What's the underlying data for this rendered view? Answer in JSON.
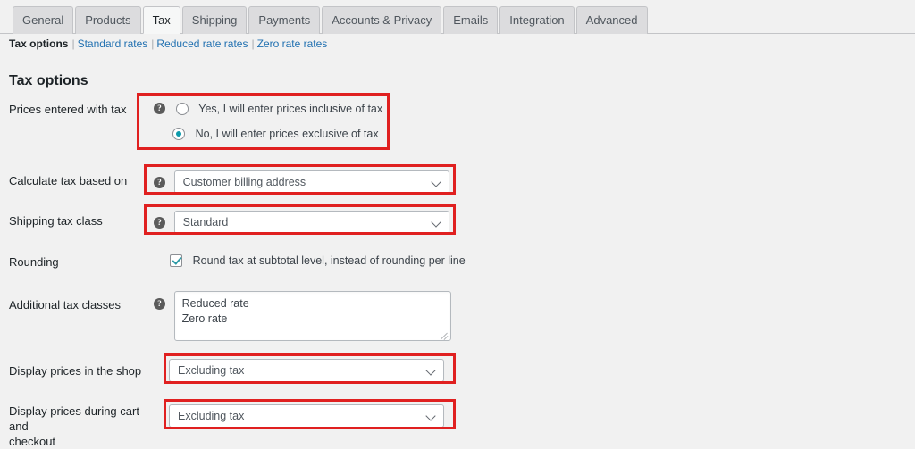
{
  "colors": {
    "accent_teal": "#0d9aab",
    "link_blue": "#2271b1",
    "annotation_red": "#e02020",
    "page_bg": "#f1f1f1"
  },
  "tabs": [
    {
      "label": "General",
      "active": false
    },
    {
      "label": "Products",
      "active": false
    },
    {
      "label": "Tax",
      "active": true
    },
    {
      "label": "Shipping",
      "active": false
    },
    {
      "label": "Payments",
      "active": false
    },
    {
      "label": "Accounts & Privacy",
      "active": false
    },
    {
      "label": "Emails",
      "active": false
    },
    {
      "label": "Integration",
      "active": false
    },
    {
      "label": "Advanced",
      "active": false
    }
  ],
  "subnav": {
    "current": "Tax options",
    "sep1": "|",
    "link1": "Standard rates",
    "sep2": "|",
    "link2": "Reduced rate rates",
    "sep3": "|",
    "link3": "Zero rate rates"
  },
  "heading": "Tax options",
  "help_glyph": "?",
  "rows": {
    "prices_entered": {
      "label": "Prices entered with tax",
      "option_yes": "Yes, I will enter prices inclusive of tax",
      "option_no": "No, I will enter prices exclusive of tax",
      "selected": "no"
    },
    "calculate_based_on": {
      "label": "Calculate tax based on",
      "value": "Customer billing address"
    },
    "shipping_tax_class": {
      "label": "Shipping tax class",
      "value": "Standard"
    },
    "rounding": {
      "label": "Rounding",
      "checkbox_label": "Round tax at subtotal level, instead of rounding per line",
      "checked": true
    },
    "additional_tax_classes": {
      "label": "Additional tax classes",
      "value_line1": "Reduced rate",
      "value_line2": "Zero rate"
    },
    "display_shop": {
      "label": "Display prices in the shop",
      "value": "Excluding tax"
    },
    "display_cart": {
      "label_line1": "Display prices during cart and",
      "label_line2": "checkout",
      "value": "Excluding tax"
    }
  }
}
